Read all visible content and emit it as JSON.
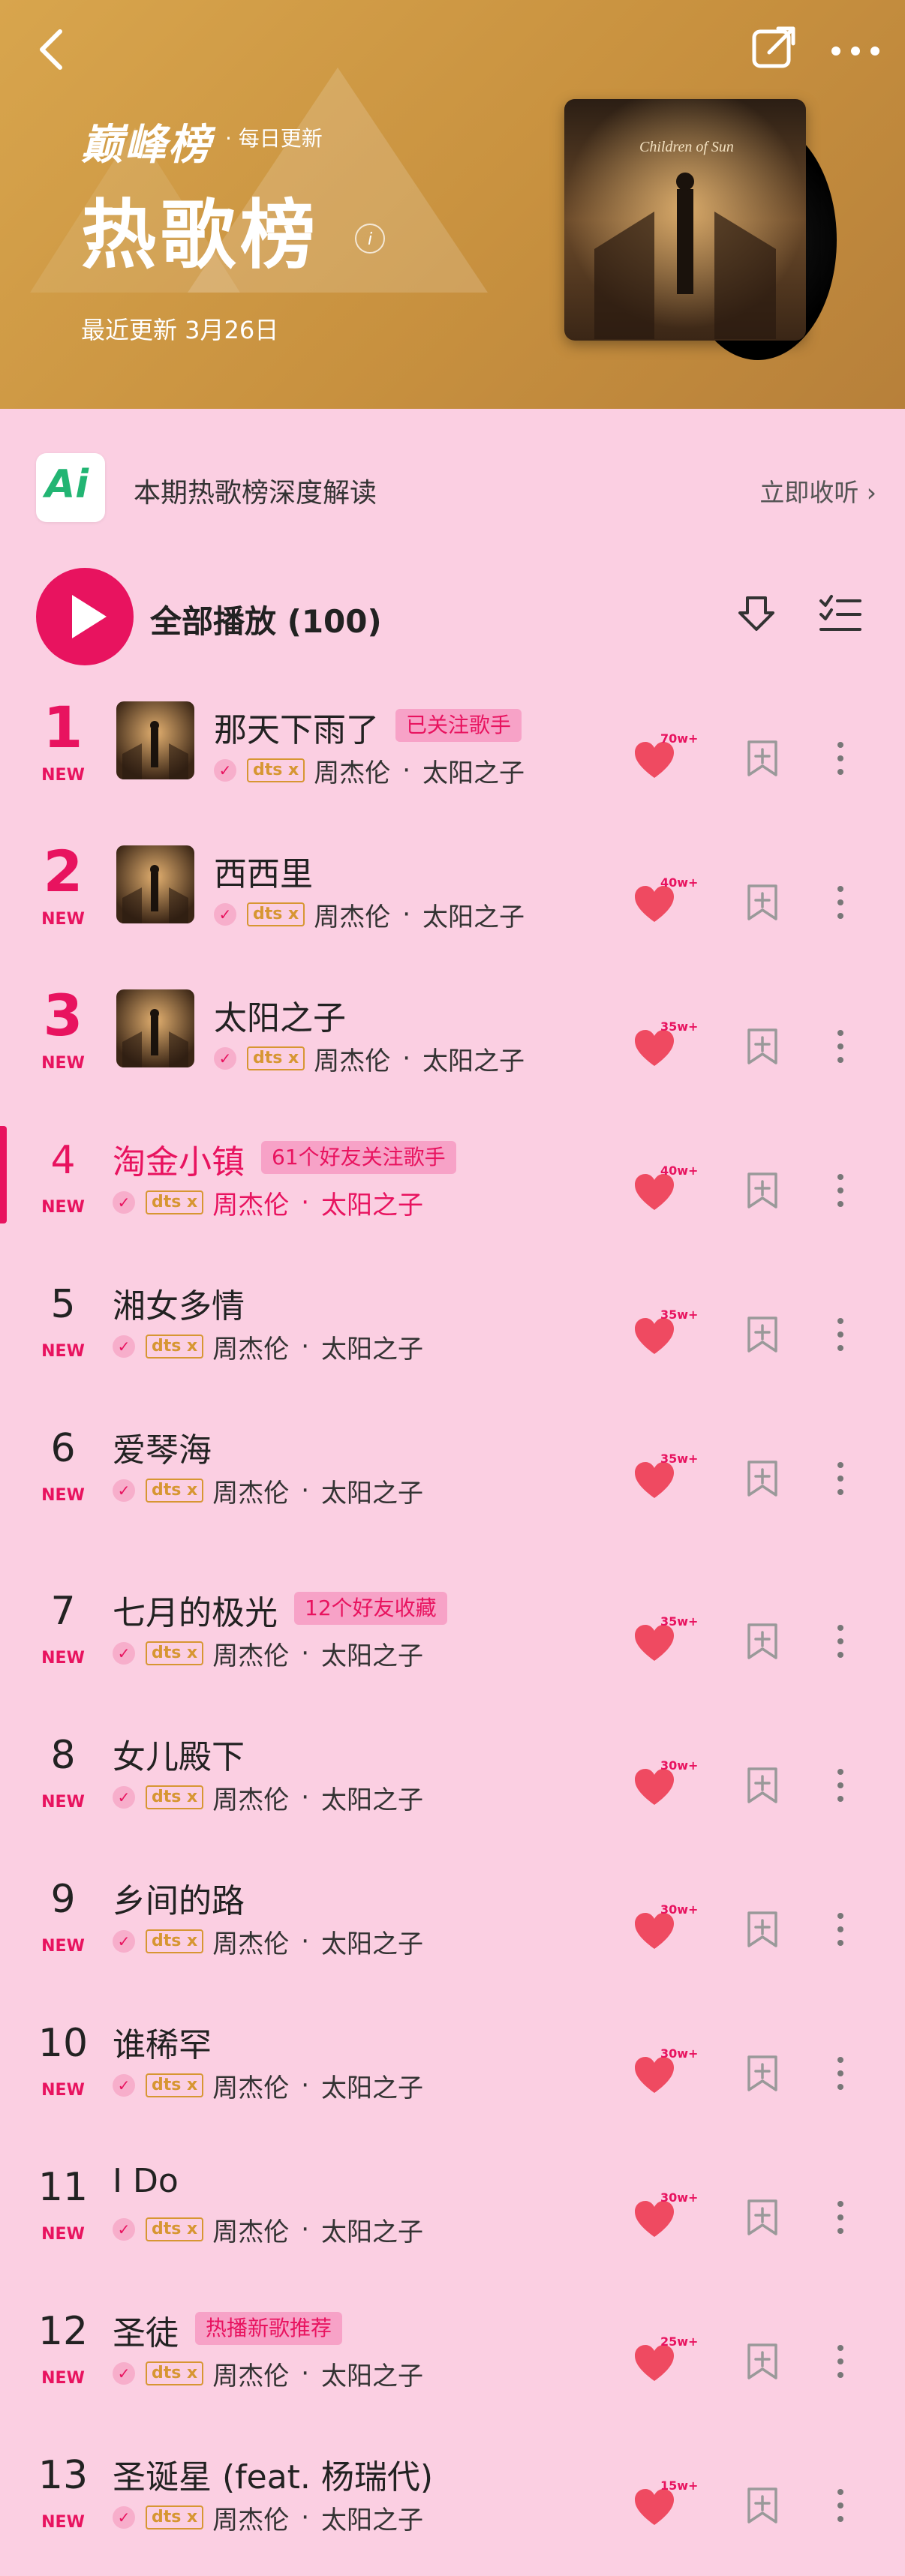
{
  "header": {
    "brand": "巅峰榜",
    "daily": "· 每日更新",
    "title": "热歌榜",
    "info_mark": "i",
    "updated": "最近更新 3月26日",
    "cover_title": "Children of Sun"
  },
  "ai": {
    "logo": "Ai",
    "text": "本期热歌榜深度解读",
    "listen": "立即收听 ›"
  },
  "play_all": {
    "label": "全部播放 (100)"
  },
  "colors": {
    "accent": "#e8135f",
    "header": "#c8913f",
    "bg": "#fbcfe2"
  },
  "songs": [
    {
      "rank": "1",
      "new": "NEW",
      "title": "那天下雨了",
      "badge": "已关注歌手",
      "dts": "dts x",
      "artist": "周杰伦",
      "sep": "·",
      "album": "太阳之子",
      "likes": "70w+",
      "thumb": true
    },
    {
      "rank": "2",
      "new": "NEW",
      "title": "西西里",
      "badge": "",
      "dts": "dts x",
      "artist": "周杰伦",
      "sep": "·",
      "album": "太阳之子",
      "likes": "40w+",
      "thumb": true
    },
    {
      "rank": "3",
      "new": "NEW",
      "title": "太阳之子",
      "badge": "",
      "dts": "dts x",
      "artist": "周杰伦",
      "sep": "·",
      "album": "太阳之子",
      "likes": "35w+",
      "thumb": true
    },
    {
      "rank": "4",
      "new": "NEW",
      "title": "淘金小镇",
      "badge": "61个好友关注歌手",
      "dts": "dts x",
      "artist": "周杰伦",
      "sep": "·",
      "album": "太阳之子",
      "likes": "40w+",
      "thumb": false,
      "current": true
    },
    {
      "rank": "5",
      "new": "NEW",
      "title": "湘女多情",
      "badge": "",
      "dts": "dts x",
      "artist": "周杰伦",
      "sep": "·",
      "album": "太阳之子",
      "likes": "35w+",
      "thumb": false
    },
    {
      "rank": "6",
      "new": "NEW",
      "title": "爱琴海",
      "badge": "",
      "dts": "dts x",
      "artist": "周杰伦",
      "sep": "·",
      "album": "太阳之子",
      "likes": "35w+",
      "thumb": false
    },
    {
      "rank": "7",
      "new": "NEW",
      "title": "七月的极光",
      "badge": "12个好友收藏",
      "dts": "dts x",
      "artist": "周杰伦",
      "sep": "·",
      "album": "太阳之子",
      "likes": "35w+",
      "thumb": false
    },
    {
      "rank": "8",
      "new": "NEW",
      "title": "女儿殿下",
      "badge": "",
      "dts": "dts x",
      "artist": "周杰伦",
      "sep": "·",
      "album": "太阳之子",
      "likes": "30w+",
      "thumb": false
    },
    {
      "rank": "9",
      "new": "NEW",
      "title": "乡间的路",
      "badge": "",
      "dts": "dts x",
      "artist": "周杰伦",
      "sep": "·",
      "album": "太阳之子",
      "likes": "30w+",
      "thumb": false
    },
    {
      "rank": "10",
      "new": "NEW",
      "title": "谁稀罕",
      "badge": "",
      "dts": "dts x",
      "artist": "周杰伦",
      "sep": "·",
      "album": "太阳之子",
      "likes": "30w+",
      "thumb": false
    },
    {
      "rank": "11",
      "new": "NEW",
      "title": "I Do",
      "badge": "",
      "dts": "dts x",
      "artist": "周杰伦",
      "sep": "·",
      "album": "太阳之子",
      "likes": "30w+",
      "thumb": false
    },
    {
      "rank": "12",
      "new": "NEW",
      "title": "圣徒",
      "badge": "热播新歌推荐",
      "dts": "dts x",
      "artist": "周杰伦",
      "sep": "·",
      "album": "太阳之子",
      "likes": "25w+",
      "thumb": false
    },
    {
      "rank": "13",
      "new": "NEW",
      "title": "圣诞星 (feat. 杨瑞代)",
      "badge": "",
      "dts": "dts x",
      "artist": "周杰伦",
      "sep": "·",
      "album": "太阳之子",
      "likes": "15w+",
      "thumb": false
    }
  ]
}
